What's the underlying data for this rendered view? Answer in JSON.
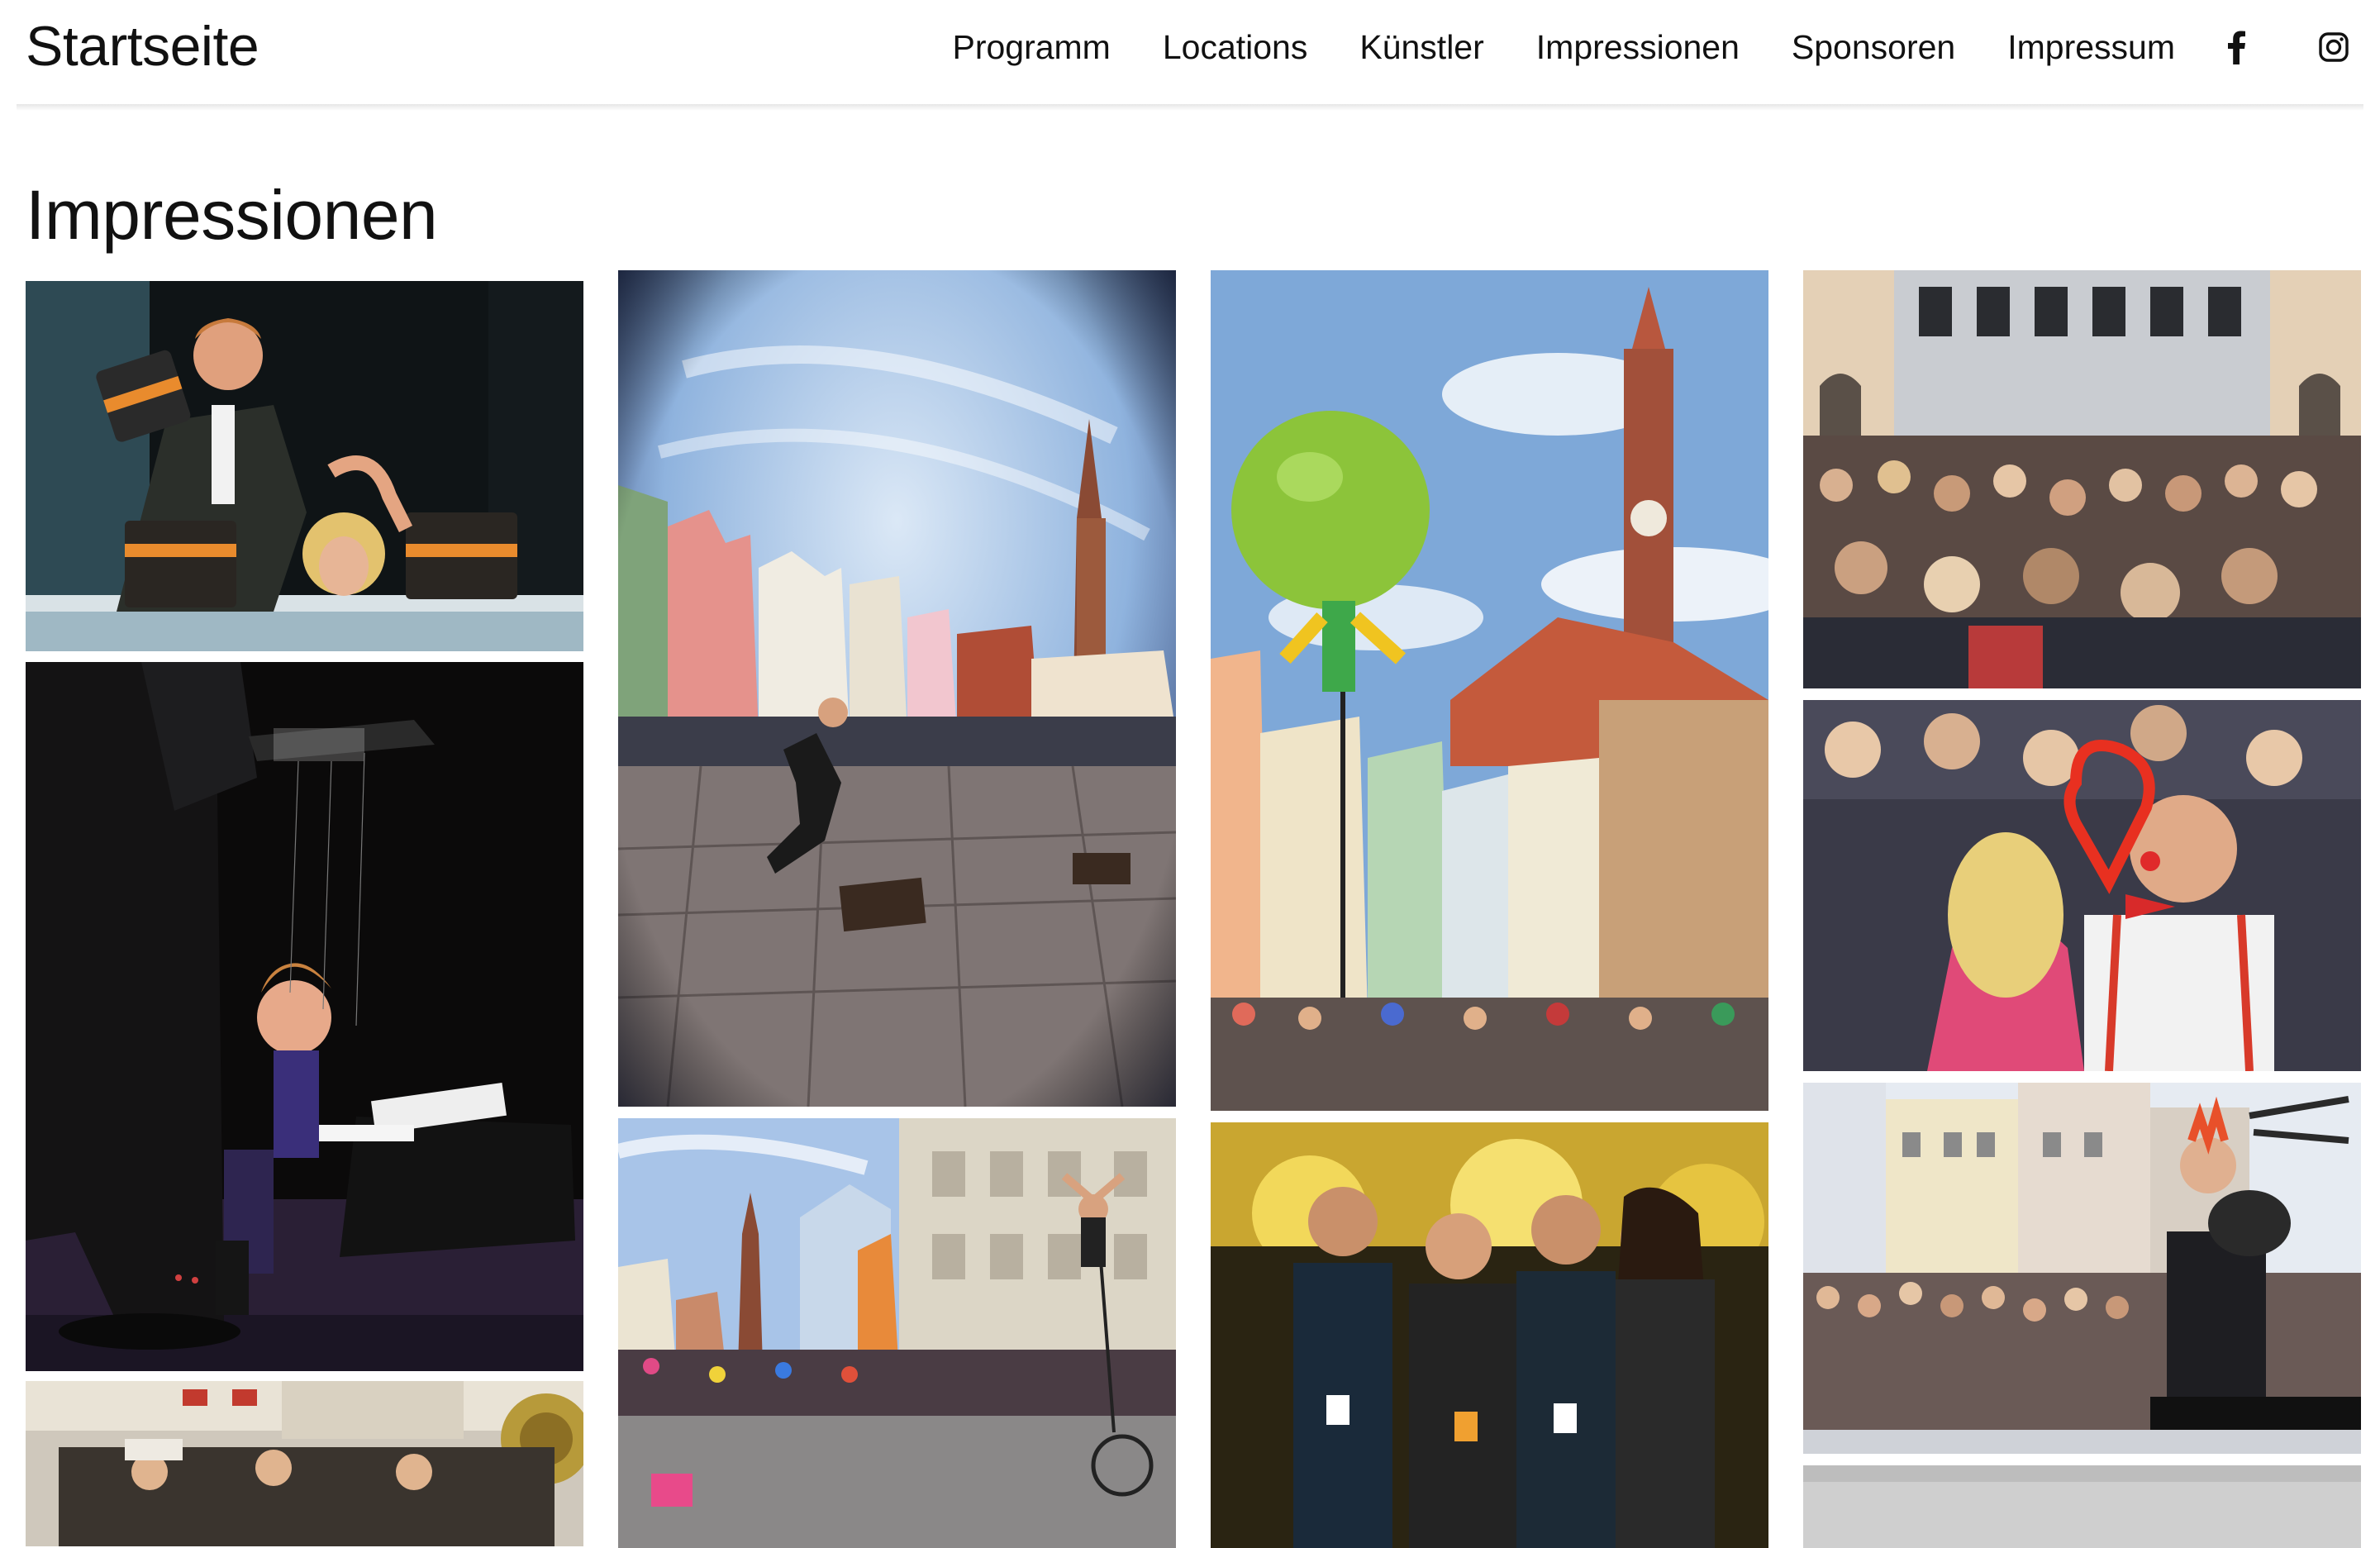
{
  "header": {
    "brand": "Startseite",
    "nav": [
      {
        "label": "Programm"
      },
      {
        "label": "Locations"
      },
      {
        "label": "Künstler"
      },
      {
        "label": "Impressionen"
      },
      {
        "label": "Sponsoren"
      },
      {
        "label": "Impressum"
      }
    ],
    "social": [
      {
        "icon": "facebook-icon"
      },
      {
        "icon": "instagram-icon"
      }
    ]
  },
  "main": {
    "title": "Impressionen"
  },
  "colors": {
    "text": "#111111",
    "background": "#ffffff",
    "divider_shadow": "#e6e6e6"
  }
}
